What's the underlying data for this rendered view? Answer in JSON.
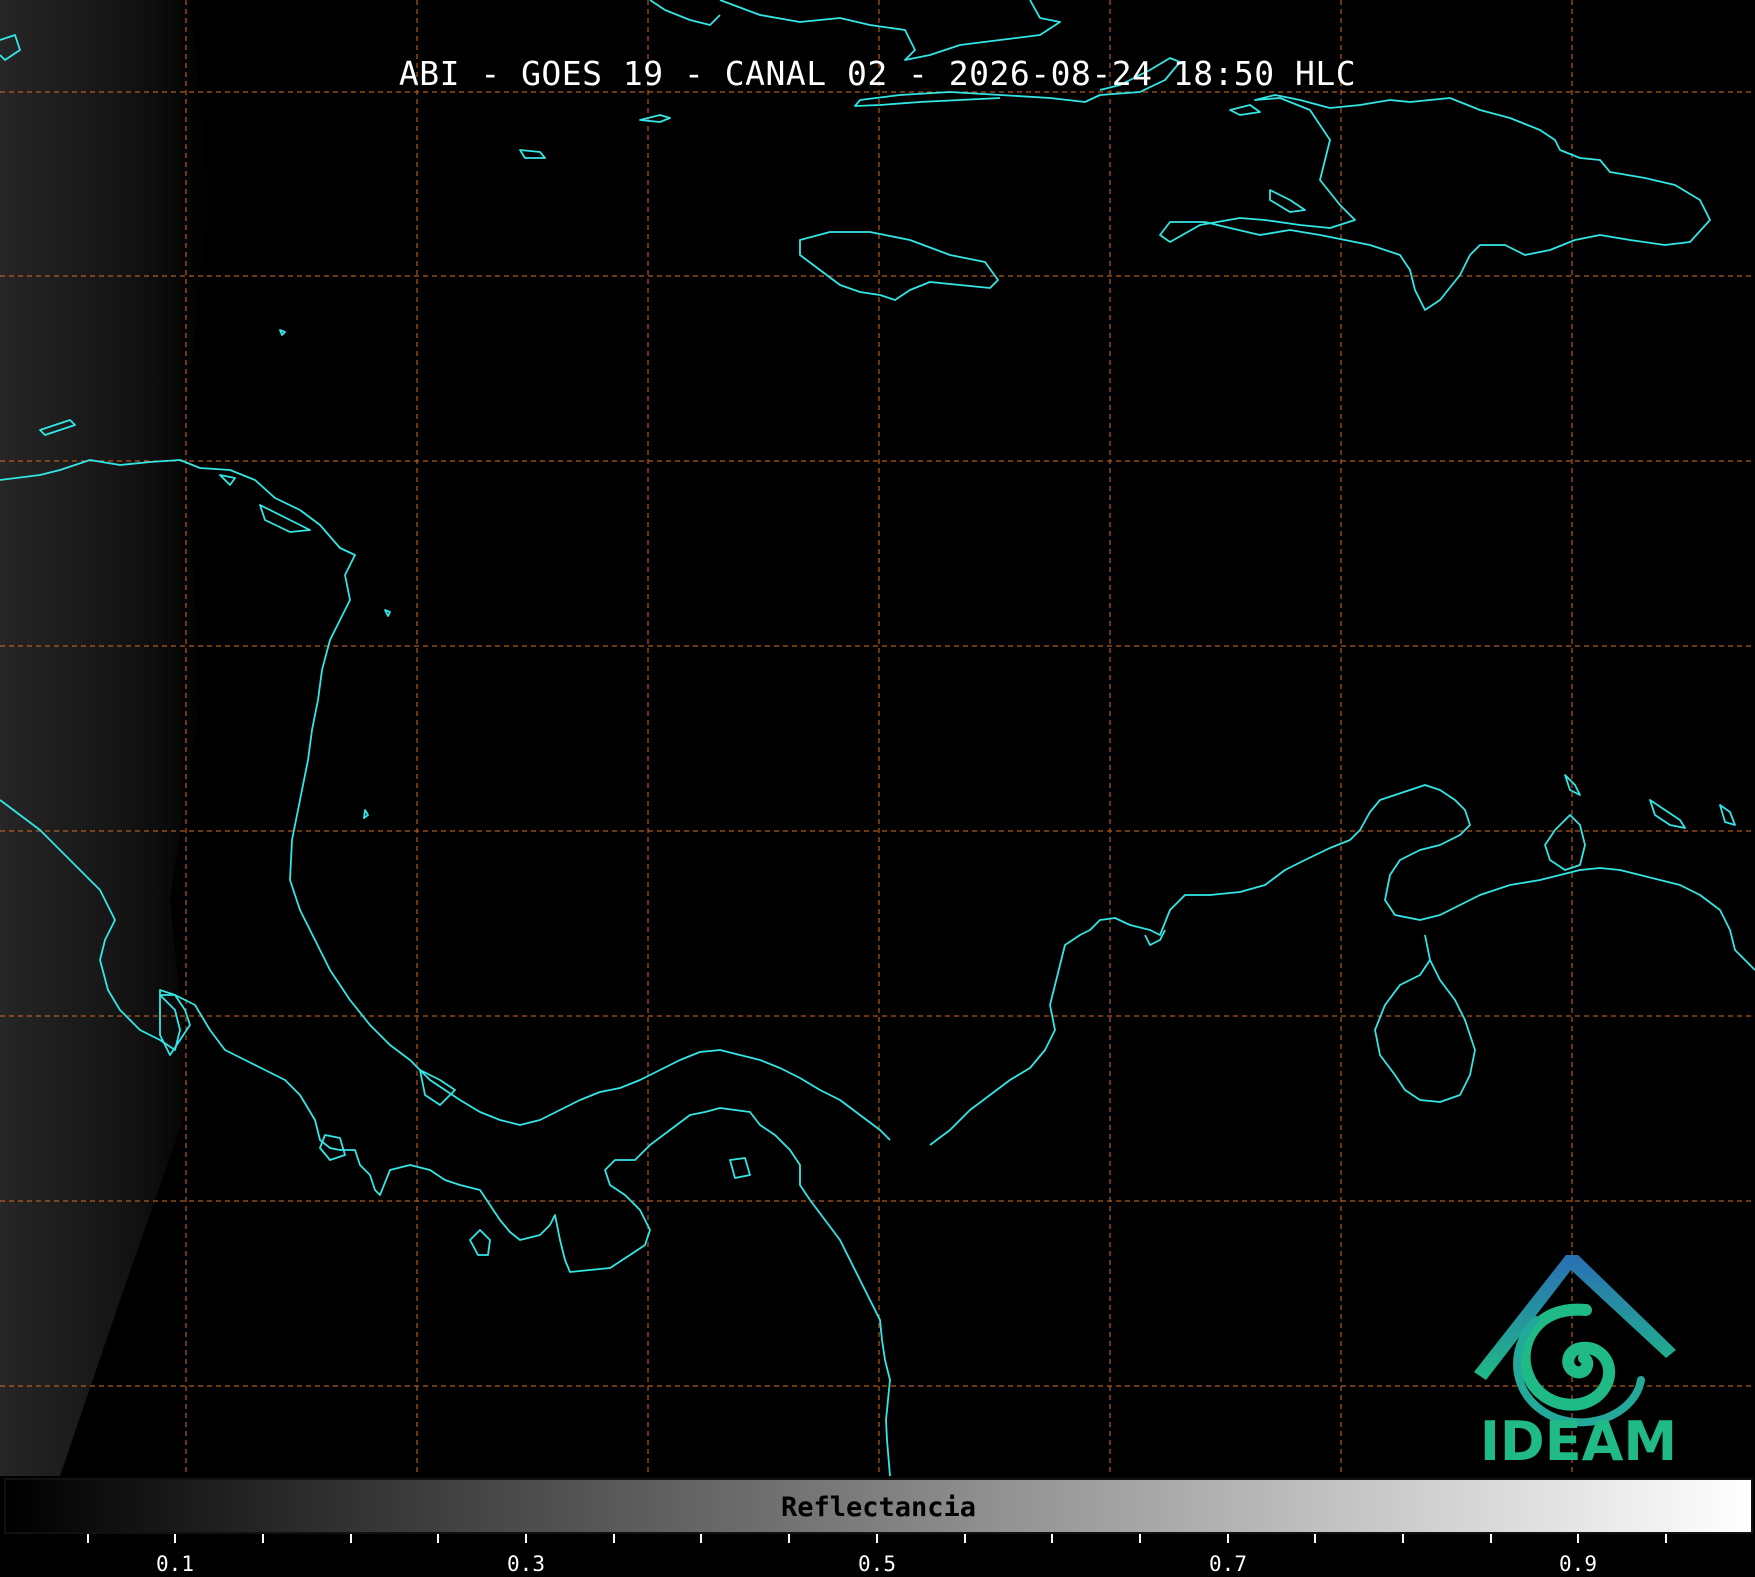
{
  "title": "ABI - GOES 19 - CANAL 02 - 2026-08-24 18:50 HLC",
  "colorbar": {
    "label": "Reflectancia",
    "tick_labels": [
      "0.1",
      "0.3",
      "0.5",
      "0.7",
      "0.9"
    ],
    "range": [
      0.0,
      1.0
    ],
    "colormap": "grayscale"
  },
  "logo": {
    "text": "IDEAM"
  },
  "colors": {
    "coastline": "#33e6e6",
    "graticule": "#d2691e",
    "background": "#000000",
    "logo_blue": "#2a6fb5",
    "logo_green": "#1fba86"
  }
}
